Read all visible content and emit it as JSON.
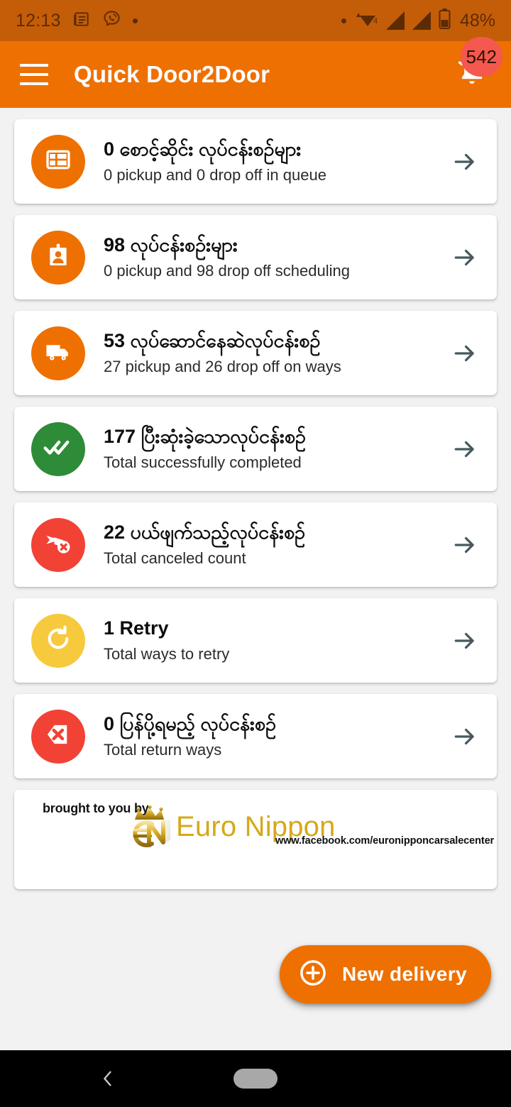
{
  "status_bar": {
    "time": "12:13",
    "battery_text": "48%",
    "signal_label": "4",
    "icons": [
      "news-icon",
      "viber-icon",
      "dot-icon",
      "wifi-icon",
      "signal-icon",
      "signal-icon",
      "battery-icon"
    ]
  },
  "app_bar": {
    "menu_icon": "hamburger-menu-icon",
    "title": "Quick Door2Door",
    "notification_icon": "bell-icon",
    "notification_count": "542",
    "background_color": "#EE7000",
    "badge_color": "#F4584F"
  },
  "cards": [
    {
      "count": "0",
      "title": "0 စောင့်ဆိုင်း လုပ်ငန်းစဉ်များ",
      "subtitle": "0 pickup and 0 drop off in queue",
      "icon": "list-icon",
      "icon_color": "#EE7000",
      "arrow": "arrow-right-icon"
    },
    {
      "count": "98",
      "title": "98 လုပ်ငန်းစဉ်းများ",
      "subtitle": "0 pickup and 98 drop off scheduling",
      "icon": "id-badge-icon",
      "icon_color": "#EE7000",
      "arrow": "arrow-right-icon"
    },
    {
      "count": "53",
      "title": "53 လုပ်ဆောင်နေဆဲလုပ်ငန်းစဉ်",
      "subtitle": "27 pickup and 26 drop off on ways",
      "icon": "truck-icon",
      "icon_color": "#EE7000",
      "arrow": "arrow-right-icon"
    },
    {
      "count": "177",
      "title": "177 ပြီးဆုံးခဲ့သောလုပ်ငန်းစဉ်",
      "subtitle": "Total successfully completed",
      "icon": "double-check-icon",
      "icon_color": "#2E8B37",
      "arrow": "arrow-right-icon"
    },
    {
      "count": "22",
      "title": "22 ပယ်ဖျက်သည့်လုပ်ငန်းစဉ်",
      "subtitle": "Total canceled count",
      "icon": "send-cancel-icon",
      "icon_color": "#F24236",
      "arrow": "arrow-right-icon"
    },
    {
      "count": "1",
      "title": "1 Retry",
      "subtitle": "Total ways to retry",
      "icon": "retry-icon",
      "icon_color": "#F6C githubA3C"
    },
    {
      "count": "0",
      "title": "0 ပြန်ပို့ရမည့် လုပ်ငန်းစဉ်",
      "subtitle": "Total return ways",
      "icon": "return-cancel-icon",
      "icon_color": "#F24236",
      "arrow": "arrow-right-icon"
    }
  ],
  "banner": {
    "brought_by": "brought to you by",
    "brand_name": "Euro Nippon",
    "url": "www.facebook.com/euronipponcarsalecenter",
    "logo_icon": "euro-nippon-crown-logo",
    "brand_color": "#D6A81A"
  },
  "fab": {
    "label": "New delivery",
    "icon": "plus-circle-icon",
    "color": "#EE7000"
  },
  "nav_bar": {
    "back_icon": "back-chevron-icon",
    "home_icon": "home-pill-icon"
  }
}
